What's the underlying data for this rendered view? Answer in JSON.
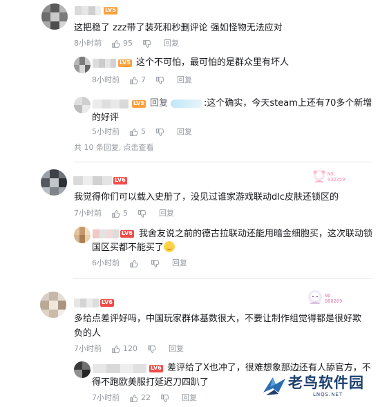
{
  "colors": {
    "lv5": "#ff9f3e",
    "lv6": "#f04c49",
    "meta": "#9499a0",
    "text": "#18191c",
    "fan_badge": "#ff8cb0"
  },
  "icons": {
    "like": "thumbs-up-icon",
    "dislike": "thumbs-down-icon"
  },
  "reply_action": "回复",
  "thread1": {
    "level": "LV5",
    "text": "这把稳了 zzz带了装死和秒删评论 强如怪物无法应对",
    "time": "8小时前",
    "likes": "95",
    "replies": [
      {
        "level": "LV5",
        "text": "这个不可怕，最可怕的是群众里有坏人",
        "time": "8小时前",
        "likes": "7"
      },
      {
        "level": "LV5",
        "reply_label": "回复",
        "text_line1": ":这个确实，今天steam上还有70多个新增",
        "text_line2": "的好评",
        "time": "5小时前",
        "likes": "5"
      }
    ],
    "more": "共 10 条回复,",
    "view": "点击查看"
  },
  "thread2": {
    "level": "LV6",
    "fan_no": "NO.\n032359",
    "text": "我觉得你们可以载入史册了，没见过谁家游戏联动dlc皮肤还锁区的",
    "time": "7小时前",
    "likes": "5",
    "replies": [
      {
        "level": "LV6",
        "text_line1": "我舍友说之前的德古拉联动还能用暗金细胞买，这次联动锁",
        "text_line2": "国区买都不能买了",
        "time": "6小时前"
      }
    ]
  },
  "thread3": {
    "level": "LV6",
    "fan_no": "NO.\n000209",
    "text_line1": "多给点差评好吗，中国玩家群体基数很大，不要让制作组觉得都是很好欺",
    "text_line2": "负的人",
    "time": "7小时前",
    "likes": "120",
    "replies": [
      {
        "level": "LV6",
        "text_line1": "差评给了X也冲了，很难想象那边还有人舔官方，不",
        "text_line2": "得不跑欧美服打延迟刀四趴了",
        "time": "7小时前",
        "likes": "22"
      }
    ]
  },
  "watermark": {
    "title": "老鸟软件园",
    "url": "LNQS.NET"
  }
}
